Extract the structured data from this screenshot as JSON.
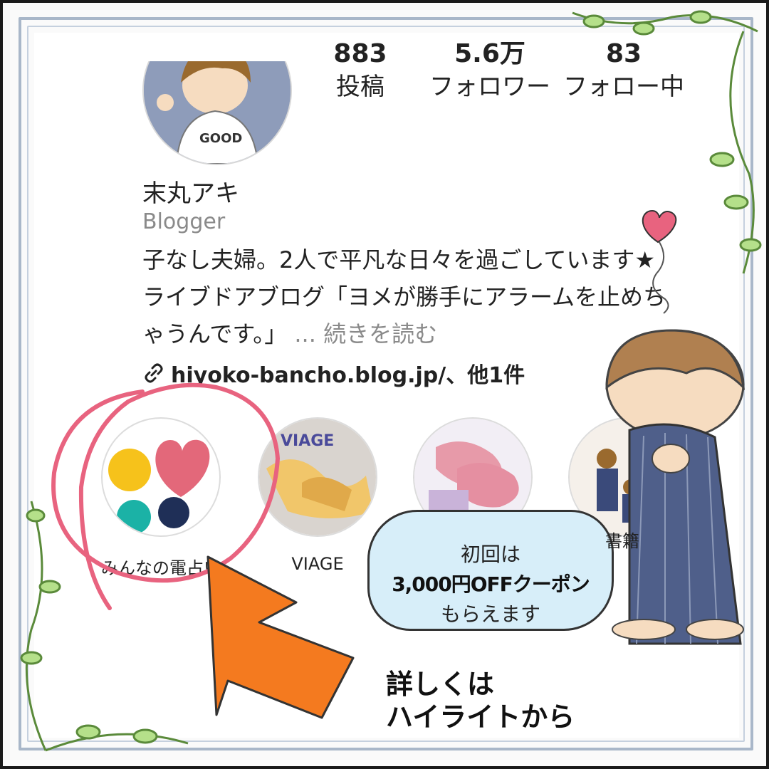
{
  "profile": {
    "name": "末丸アキ",
    "category": "Blogger",
    "bio_line1": "子なし夫婦。2人で平凡な日々を過ごしています★",
    "bio_line2": "ライブドアブログ「ヨメが勝手にアラームを止めち",
    "bio_line3": "ゃうんです。」",
    "more": "... 続きを読む",
    "link": "hiyoko-bancho.blog.jp/、他1件",
    "avatar_shirt_text": "GOOD"
  },
  "stats": [
    {
      "value": "883",
      "label": "投稿"
    },
    {
      "value": "5.6万",
      "label": "フォロワー"
    },
    {
      "value": "83",
      "label": "フォロー中"
    }
  ],
  "highlights": [
    {
      "label": "みんなの電占い"
    },
    {
      "label": "VIAGE",
      "thumb_text": "VIAGE"
    },
    {
      "label": ""
    },
    {
      "label": "書籍"
    }
  ],
  "bubble": {
    "line1": "初回は",
    "line2": "3,000円OFFクーポン",
    "line3": "もらえます"
  },
  "note": {
    "line1": "詳しくは",
    "line2": "ハイライトから"
  },
  "colors": {
    "frame": "#a9b7c9",
    "circle_annotation": "#e8637f",
    "arrow": "#f47a1f",
    "bubble": "#d7eef9",
    "yellow_dot": "#f6c21b",
    "heart": "#e3687a",
    "teal_dot": "#1bb2a6",
    "navy_dot": "#1f2f57"
  },
  "icons": [
    "link-icon",
    "heart-icon",
    "vine-decoration"
  ]
}
